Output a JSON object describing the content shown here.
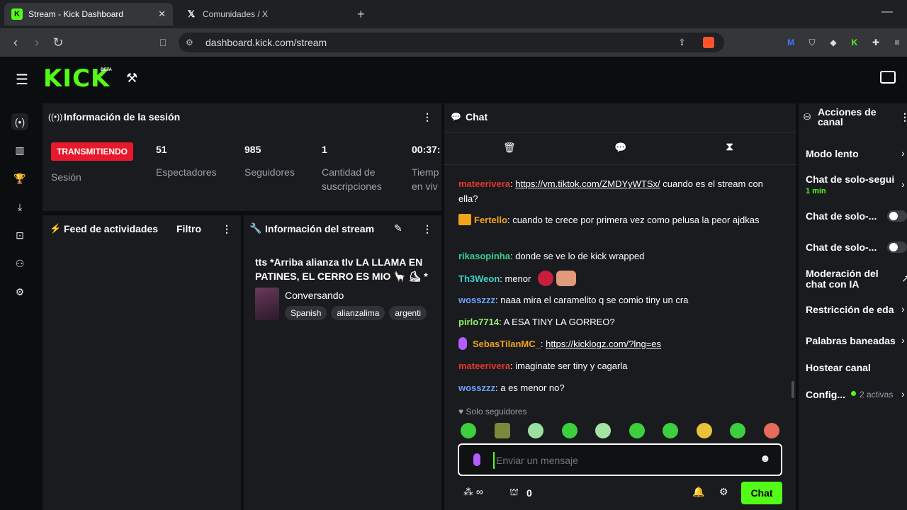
{
  "browser": {
    "tabs": [
      {
        "title": "Stream - Kick Dashboard",
        "active": true,
        "favicon": "K"
      },
      {
        "title": "Comunidades / X",
        "active": false,
        "favicon": "X"
      }
    ],
    "url": "dashboard.kick.com/stream"
  },
  "header": {
    "logo": "KICK",
    "beta": "BETA"
  },
  "session": {
    "title": "Información de la sesión",
    "status_badge": "TRANSMITIENDO",
    "status_label": "Sesión",
    "stats": [
      {
        "value": "51",
        "label": "Espectadores"
      },
      {
        "value": "985",
        "label": "Seguidores"
      },
      {
        "value": "1",
        "label": "Cantidad de suscripciones"
      },
      {
        "value": "00:37:",
        "label": "Tiempo en vivo"
      }
    ],
    "stats_labels_display": [
      "Espectadores",
      "Seguidores",
      "Cantidad de",
      "suscripciones",
      "Tiemp",
      "en viv"
    ]
  },
  "activity_feed": {
    "title": "Feed de actividades",
    "filter_label": "Filtro"
  },
  "stream_info": {
    "title": "Información del stream",
    "stream_title": "tts *Arriba alianza tlv LA LLAMA EN PATINES, EL CERRO ES MIO 🦙 ⛸ *",
    "category": "Conversando",
    "tags": [
      "Spanish",
      "alianzalima",
      "argenti"
    ]
  },
  "chat": {
    "title": "Chat",
    "messages": [
      {
        "user": "mateerivera",
        "color": "#e8372a",
        "text": ": ",
        "link": "https://vm.tiktok.com/ZMDYyWTSx/",
        "after": " cuando es el stream con ella?"
      },
      {
        "user": "Fertello",
        "color": "#f2a41b",
        "text": ": cuando te crece por primera vez como pelusa la peor ajdkas",
        "badge": "crown"
      },
      {
        "user": "rikasopinha",
        "color": "#35d08f",
        "text": ": donde se ve lo de kick wrapped"
      },
      {
        "user": "Th3Weon",
        "color": "#3ad6c9",
        "text": ": menor"
      },
      {
        "user": "wosszzz",
        "color": "#6aa1ff",
        "text": ": naaa mira el caramelito q se comio tiny un cra"
      },
      {
        "user": "pirlo7714",
        "color": "#8ef36a",
        "text": ": A ESA TINY LA GORREO?"
      },
      {
        "user": "SebasTilanMC_",
        "color": "#f0a21b",
        "text": ": ",
        "link": "https://kicklogz.com/?lng=es",
        "badge": "mic"
      },
      {
        "user": "mateerivera",
        "color": "#e8372a",
        "text": ": imaginate ser tiny y cagarla"
      },
      {
        "user": "wosszzz",
        "color": "#6aa1ff",
        "text": ": a es menor no?"
      }
    ],
    "followers_only": "Solo seguidores",
    "input_placeholder": "Enviar un mensaje",
    "points": "0",
    "send_label": "Chat"
  },
  "actions": {
    "title": "Acciones de canal",
    "items": [
      {
        "label": "Modo lento"
      },
      {
        "label": "Chat de solo-segui",
        "sub": "1 min"
      },
      {
        "label": "Chat de solo-..."
      },
      {
        "label": "Chat de solo-..."
      },
      {
        "label": "Moderación del chat con IA"
      },
      {
        "label": "Restricción de eda"
      },
      {
        "label": "Palabras baneadas"
      },
      {
        "label": "Hostear canal"
      },
      {
        "label": "Config...",
        "sub": "2 activas"
      }
    ]
  },
  "colors": {
    "accent": "#53fc18",
    "live_badge": "#e8192c",
    "panel_bg": "#191b1f"
  }
}
